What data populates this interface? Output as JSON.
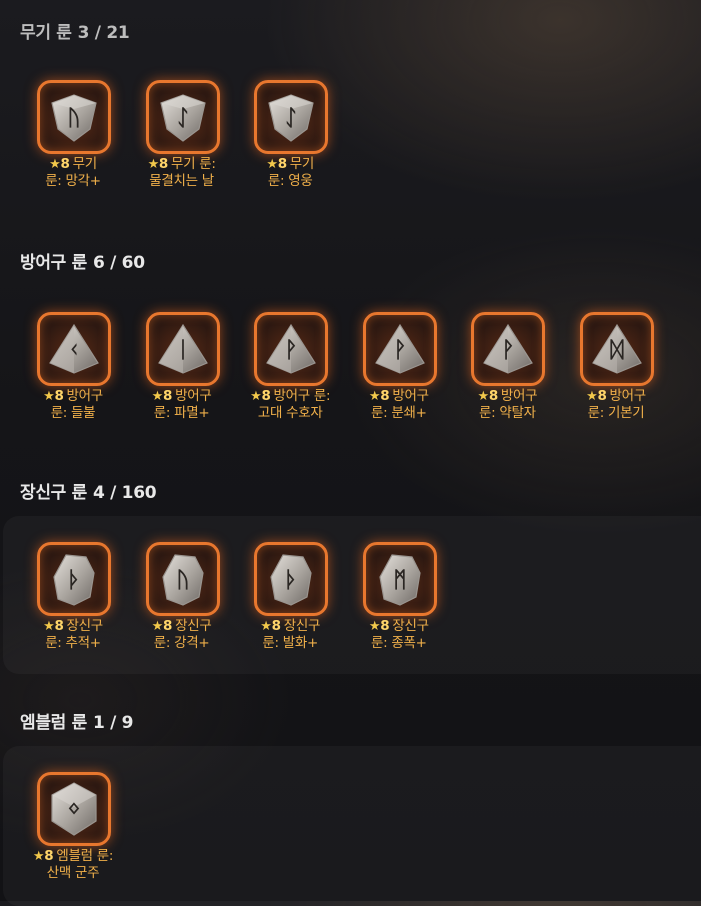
{
  "sections": [
    {
      "title": "무기 룬",
      "count": "3 / 21",
      "items": [
        {
          "grade": "8",
          "line1": "무기",
          "line2": "룬: 망각+",
          "shape": "shield",
          "glyph": "ᚢ"
        },
        {
          "grade": "8",
          "line1": "무기 룬:",
          "line2": "물결치는 날",
          "shape": "shield",
          "glyph": "ᛇ"
        },
        {
          "grade": "8",
          "line1": "무기",
          "line2": "룬: 영웅",
          "shape": "shield",
          "glyph": "ᛇ"
        }
      ]
    },
    {
      "title": "방어구 룬",
      "count": "6 / 60",
      "items": [
        {
          "grade": "8",
          "line1": "방어구",
          "line2": "룬: 들불",
          "shape": "pyramid",
          "glyph": "ᚲ"
        },
        {
          "grade": "8",
          "line1": "방어구",
          "line2": "룬: 파멸+",
          "shape": "pyramid",
          "glyph": "ᛁ"
        },
        {
          "grade": "8",
          "line1": "방어구 룬:",
          "line2": "고대 수호자",
          "shape": "pyramid",
          "glyph": "ᚹ"
        },
        {
          "grade": "8",
          "line1": "방어구",
          "line2": "룬: 분쇄+",
          "shape": "pyramid",
          "glyph": "ᚹ"
        },
        {
          "grade": "8",
          "line1": "방어구",
          "line2": "룬: 약탈자",
          "shape": "pyramid",
          "glyph": "ᚹ"
        },
        {
          "grade": "8",
          "line1": "방어구",
          "line2": "룬: 기본기",
          "shape": "pyramid",
          "glyph": "ᛞ"
        }
      ]
    },
    {
      "title": "장신구 룬",
      "count": "4 / 160",
      "items": [
        {
          "grade": "8",
          "line1": "장신구",
          "line2": "룬: 추적+",
          "shape": "stone",
          "glyph": "ᚦ"
        },
        {
          "grade": "8",
          "line1": "장신구",
          "line2": "룬: 강격+",
          "shape": "stone",
          "glyph": "ᚢ"
        },
        {
          "grade": "8",
          "line1": "장신구",
          "line2": "룬: 발화+",
          "shape": "stone",
          "glyph": "ᚦ"
        },
        {
          "grade": "8",
          "line1": "장신구",
          "line2": "룬: 종폭+",
          "shape": "stone",
          "glyph": "ᛗ"
        }
      ]
    },
    {
      "title": "엠블럼 룬",
      "count": "1 / 9",
      "items": [
        {
          "grade": "8",
          "line1": "엠블럼 룬:",
          "line2": "산맥 군주",
          "shape": "hex",
          "glyph": "ᛜ"
        }
      ]
    }
  ],
  "colors": {
    "frame": "#e8772e",
    "caption": "#f0b04a",
    "grade": "#ffd56a",
    "star": "#f2c84b"
  },
  "star_icon": "star-icon"
}
